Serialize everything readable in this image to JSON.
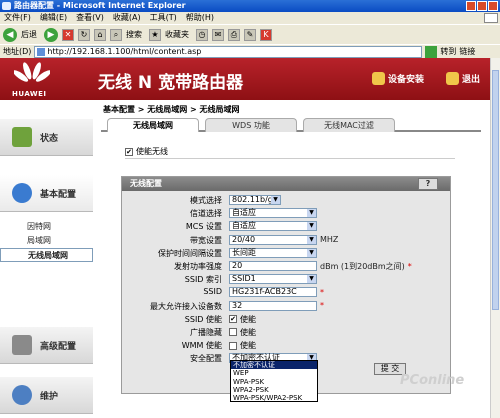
{
  "browser": {
    "window_title": "路由器配置 - Microsoft Internet Explorer",
    "menu": [
      "文件(F)",
      "编辑(E)",
      "查看(V)",
      "收藏(A)",
      "工具(T)",
      "帮助(H)"
    ],
    "back_label": "后退",
    "search_label": "搜索",
    "favorites_label": "收藏夹",
    "address_label": "地址(D)",
    "url": "http://192.168.1.100/html/content.asp",
    "go_label": "转到",
    "links_label": "链接"
  },
  "header": {
    "logo_text": "HUAWEI",
    "product_title": "无线 N 宽带路由器",
    "device_install": "设备安装",
    "exit": "退出"
  },
  "nav": {
    "status": "状态",
    "basic_config": "基本配置",
    "advanced_config": "高级配置",
    "maintenance": "维护",
    "sub_items": [
      "因特网",
      "局域网",
      "无线局域网"
    ]
  },
  "main": {
    "breadcrumb": "基本配置 > 无线局域网 > 无线局域网",
    "tabs": [
      "无线局域网",
      "WDS 功能",
      "无线MAC过滤"
    ],
    "enable_wireless": "使能无线",
    "panel_title": "无线配置",
    "help": "?",
    "form": {
      "mode_label": "模式选择",
      "mode_value": "802.11b/g/n",
      "channel_label": "信道选择",
      "channel_value": "自适应",
      "mcs_label": "MCS 设置",
      "mcs_value": "自适应",
      "bandwidth_label": "带宽设置",
      "bandwidth_value": "20/40",
      "bandwidth_unit": "MHZ",
      "guard_label": "保护时间间隔设置",
      "guard_value": "长间距",
      "power_label": "发射功率强度",
      "power_value": "20",
      "power_unit": "dBm (1到20dBm之间)",
      "ssid_index_label": "SSID 索引",
      "ssid_index_value": "SSID1",
      "ssid_label": "SSID",
      "ssid_value": "HG231f-ACB23C",
      "max_users_label": "最大允许接入设备数",
      "max_users_value": "32",
      "ssid_enable_label": "SSID 使能",
      "ssid_enable_text": "使能",
      "broadcast_hide_label": "广播隐藏",
      "broadcast_hide_text": "使能",
      "wmm_label": "WMM 使能",
      "wmm_text": "使能",
      "security_label": "安全配置",
      "security_value": "不加密不认证"
    },
    "submit": "提 交",
    "security_options": [
      "不加密不认证",
      "WEP",
      "WPA-PSK",
      "WPA2-PSK",
      "WPA-PSK/WPA2-PSK"
    ]
  },
  "watermark": "PConline"
}
